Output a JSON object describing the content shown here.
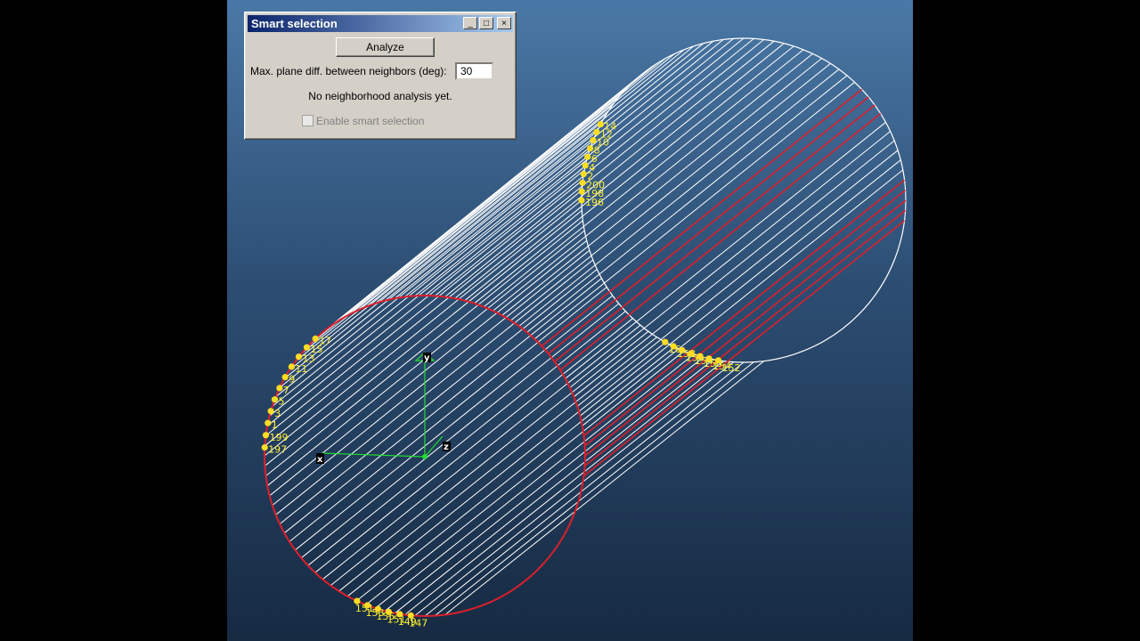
{
  "dialog": {
    "title": "Smart selection",
    "analyze_label": "Analyze",
    "plane_diff_label": "Max. plane diff. between neighbors (deg):",
    "plane_diff_value": "30",
    "status_text": "No neighborhood analysis yet.",
    "smart_selection_label": "Enable smart selection",
    "smart_selection_checked": false,
    "min_glyph": "_",
    "max_glyph": "□",
    "close_glyph": "×"
  },
  "axes": {
    "x_label": "x",
    "y_label": "y",
    "z_label": "z"
  },
  "labels": {
    "front_left": [
      "17",
      "15",
      "13",
      "11",
      "9",
      "7",
      "5",
      "3",
      "1",
      "199",
      "197"
    ],
    "front_bottom": [
      "151",
      "153",
      "155",
      "151",
      "149",
      "147"
    ],
    "back_top": [
      "14",
      "12",
      "10",
      "8",
      "6",
      "4",
      "2",
      "200",
      "198",
      "196"
    ],
    "back_bottom": [
      "16",
      "158",
      "156",
      "154",
      "150",
      "154",
      "152"
    ]
  },
  "colors": {
    "background_top": "#4a78a6",
    "background_bottom": "#162a42",
    "wire": "#ffffff",
    "selected": "#dd1f2a",
    "vertex": "#ffdd22",
    "label": "#ffee33",
    "axis": "#22dd33"
  }
}
